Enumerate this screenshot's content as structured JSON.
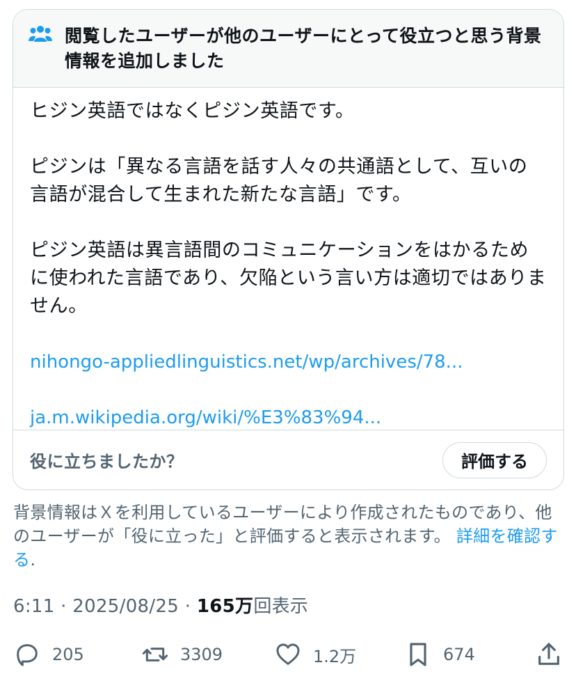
{
  "note": {
    "header": "閲覧したユーザーが他のユーザーにとって役立つと思う背景情報を追加しました",
    "paragraphs": [
      "ヒジン英語ではなくピジン英語です。",
      "ピジンは「異なる言語を話す人々の共通語として、互いの言語が混合して生まれた新たな言語」です。",
      "ピジン英語は異言語間のコミュニケーションをはかるために使われた言語であり、欠陥という言い方は適切ではありません。"
    ],
    "links": [
      "nihongo-appliedlinguistics.net/wp/archives/78...",
      "ja.m.wikipedia.org/wiki/%E3%83%94..."
    ],
    "helpful_question": "役に立ちましたか？",
    "rate_label": "評価する"
  },
  "disclaimer": {
    "text": "背景情報はＸを利用しているユーザーにより作成されたものであり、他のユーザーが「役に立った」と評価すると表示されます。",
    "link": "詳細を確認する",
    "end": "."
  },
  "meta": {
    "time_date": "6:11 · 2025/08/25 · ",
    "views_count": "165万",
    "views_label": "回表示"
  },
  "actions": {
    "reply_count": "205",
    "repost_count": "3309",
    "like_count": "1.2万",
    "bookmark_count": "674"
  },
  "icons": {
    "community": "people-icon",
    "reply": "reply-icon",
    "repost": "repost-icon",
    "like": "heart-icon",
    "bookmark": "bookmark-icon",
    "share": "share-icon"
  },
  "colors": {
    "link": "#1d9bf0",
    "secondary_text": "#536471",
    "border": "#cfd9de"
  }
}
